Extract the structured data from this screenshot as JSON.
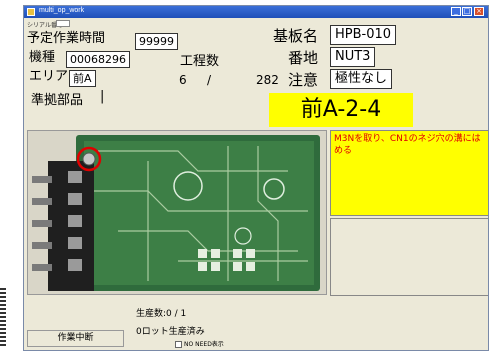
{
  "window": {
    "title": "multi_op_work"
  },
  "fields": {
    "serial_label": "シリアル番号",
    "planned_time_label": "予定作業時間",
    "planned_time_value": "99999",
    "model_label": "機種",
    "model_value": "00068296",
    "area_label": "エリア",
    "area_value": "前A",
    "process_count_label": "工程数",
    "process_current": "6",
    "process_separator": "/",
    "process_total": "282",
    "parts_label": "準拠部品",
    "parts_value": "|",
    "board_name_label": "基板名",
    "board_name_value": "HPB-010",
    "address_label": "番地",
    "address_value": "NUT3",
    "caution_label": "注意",
    "caution_value": "極性なし"
  },
  "step_location": "前A-2-4",
  "instruction_text": "M3Nを取り、CN1のネジ穴の溝にはめる",
  "status": {
    "production_count": "生産数:0 / 1",
    "lot_status": "0ロット生産済み"
  },
  "controls": {
    "stop_button_label": "作業中断",
    "no_need_label": "NO NEED表示",
    "no_need_checked": false
  },
  "colors": {
    "highlight": "#ffff00",
    "instruction_text": "#e00000",
    "marker": "#e00000",
    "window_bg": "#ece9d8",
    "titlebar": "#1f4fb8"
  }
}
